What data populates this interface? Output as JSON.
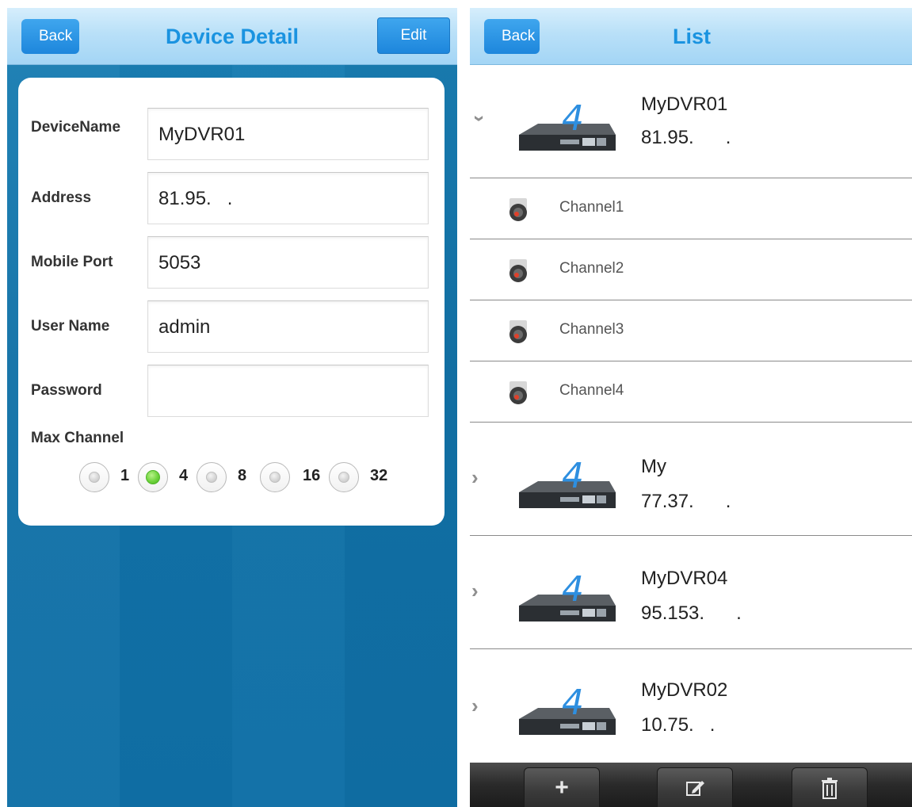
{
  "left": {
    "nav": {
      "back_label": "Back",
      "title": "Device Detail",
      "edit_label": "Edit"
    },
    "form": {
      "fields": [
        {
          "label": "DeviceName",
          "value": "MyDVR01"
        },
        {
          "label": "Address",
          "value": "81.95.   ."
        },
        {
          "label": "Mobile Port",
          "value": "5053"
        },
        {
          "label": "User Name",
          "value": "admin"
        },
        {
          "label": "Password",
          "value": ""
        }
      ],
      "max_channel_label": "Max Channel",
      "channel_options": [
        "1",
        "4",
        "8",
        "16",
        "32"
      ],
      "selected_channel": "4"
    }
  },
  "right": {
    "nav": {
      "back_label": "Back",
      "title": "List"
    },
    "devices": [
      {
        "name": "MyDVR01",
        "address": "81.95.      .",
        "expanded": true,
        "channels": [
          "Channel1",
          "Channel2",
          "Channel3",
          "Channel4"
        ]
      },
      {
        "name": "My",
        "address": "77.37.      .",
        "expanded": false
      },
      {
        "name": "MyDVR04",
        "address": "95.153.      .",
        "expanded": false
      },
      {
        "name": "MyDVR02",
        "address": "10.75.   .",
        "expanded": false
      }
    ],
    "toolbar": {
      "add_glyph": "+",
      "edit_icon": "edit-icon",
      "delete_icon": "trash-icon"
    }
  },
  "colors": {
    "accent": "#1a93e0",
    "background": "#1373a8",
    "selected_radio": "#6fd33d"
  }
}
